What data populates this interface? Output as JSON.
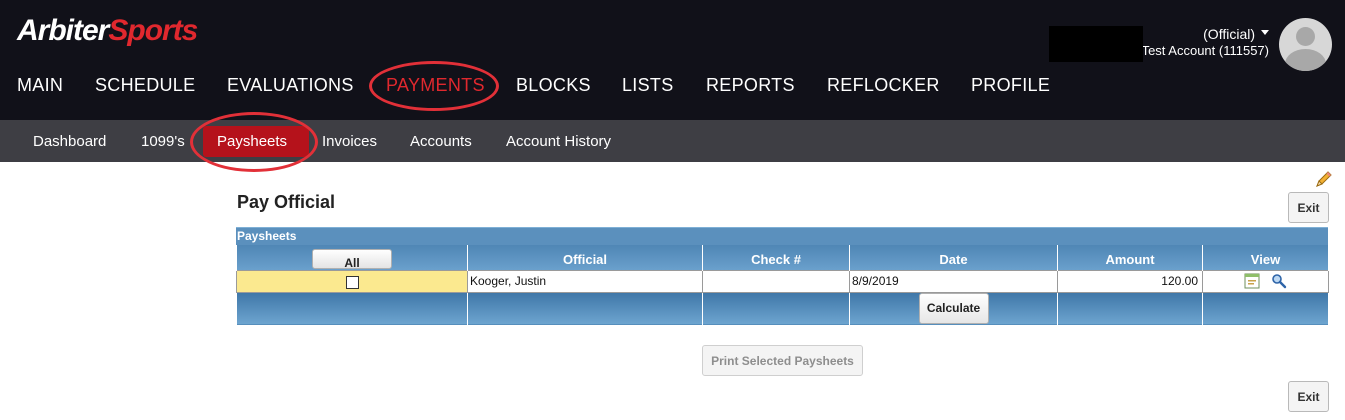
{
  "logo": {
    "part1": "Arbiter",
    "part2": "Sports"
  },
  "account": {
    "role": "(Official)",
    "name": "Test Account (111557)"
  },
  "main_nav": [
    "MAIN",
    "SCHEDULE",
    "EVALUATIONS",
    "PAYMENTS",
    "BLOCKS",
    "LISTS",
    "REPORTS",
    "REFLOCKER",
    "PROFILE"
  ],
  "sub_nav": [
    "Dashboard",
    "1099's",
    "Paysheets",
    "Invoices",
    "Accounts",
    "Account History"
  ],
  "page": {
    "title": "Pay Official",
    "exit_label": "Exit",
    "caption": "Paysheets",
    "columns": [
      "Official",
      "Check #",
      "Date",
      "Amount",
      "View"
    ],
    "all_label": "All",
    "calculate_label": "Calculate",
    "print_label": "Print Selected Paysheets"
  },
  "rows": [
    {
      "official": "Kooger, Justin",
      "check": "",
      "date": "8/9/2019",
      "amount": "120.00"
    }
  ],
  "colors": {
    "header_bg": "#111119",
    "accent": "#e0282e",
    "grid_blue": "#5b90bd",
    "highlight": "#fbe98f"
  }
}
